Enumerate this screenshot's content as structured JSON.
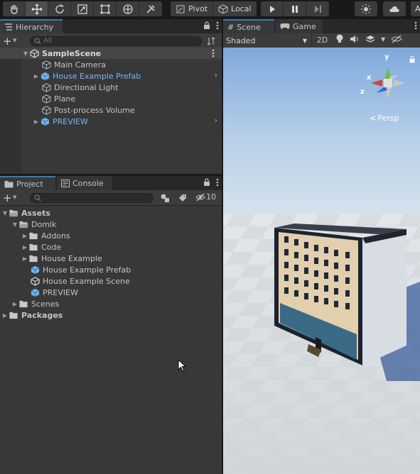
{
  "toolbar": {
    "pivot_label": "Pivot",
    "local_label": "Local",
    "account_initial": "A"
  },
  "hierarchy": {
    "tab_label": "Hierarchy",
    "search_placeholder": "All",
    "items": [
      {
        "label": "SampleScene"
      },
      {
        "label": "Main Camera"
      },
      {
        "label": "House Example Prefab"
      },
      {
        "label": "Directional Light"
      },
      {
        "label": "Plane"
      },
      {
        "label": "Post-process Volume"
      },
      {
        "label": "PREVIEW"
      }
    ]
  },
  "scene": {
    "tab_scene": "Scene",
    "tab_game": "Game",
    "shading_mode": "Shaded",
    "toggle_2d": "2D",
    "gizmo_y": "y",
    "gizmo_x": "x",
    "gizmo_z": "z",
    "projection_label": "Persp"
  },
  "project": {
    "tab_project": "Project",
    "tab_console": "Console",
    "hidden_count": "10",
    "tree": [
      {
        "label": "Assets"
      },
      {
        "label": "Domik"
      },
      {
        "label": "Addons"
      },
      {
        "label": "Code"
      },
      {
        "label": "House Example"
      },
      {
        "label": "House Example Prefab"
      },
      {
        "label": "House Example Scene"
      },
      {
        "label": "PREVIEW"
      },
      {
        "label": "Scenes"
      },
      {
        "label": "Packages"
      }
    ]
  },
  "colors": {
    "accent": "#3a79bb",
    "prefab_text": "#7ab4f5",
    "prefab_icon": "#6fb3f0",
    "panel_bg": "#383838"
  }
}
